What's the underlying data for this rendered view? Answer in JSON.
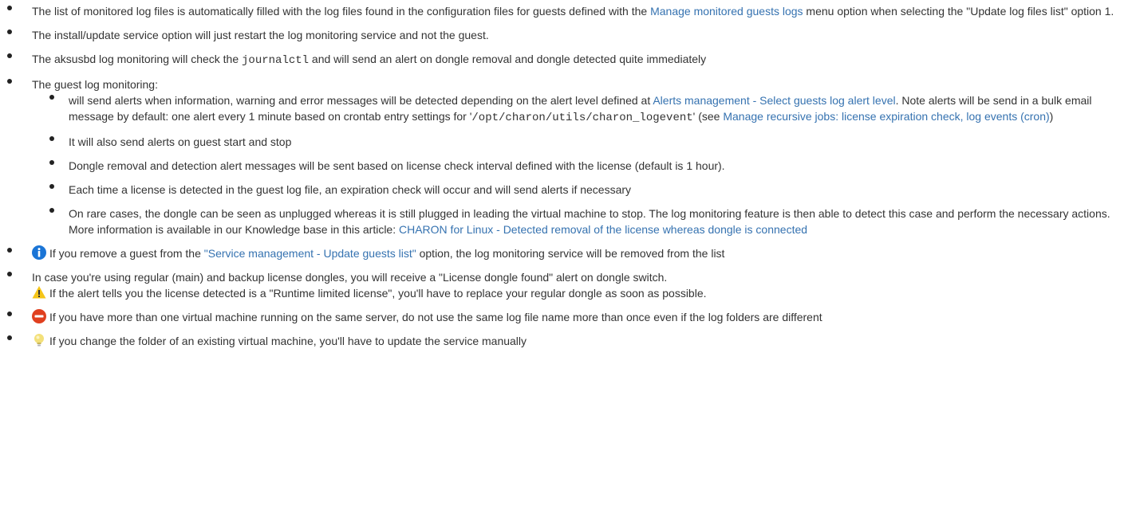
{
  "items": {
    "b1": {
      "t1": "The list of monitored log files is automatically filled with the log files found in the configuration files for guests defined with the ",
      "link": "Manage monitored guests logs",
      "t2": " menu option when selecting the \"Update log files list\" option 1."
    },
    "b2": {
      "t1": "The install/update service option will just restart the log monitoring service and not the guest."
    },
    "b3": {
      "t1": "The aksusbd log monitoring will check the ",
      "code": "journalctl",
      "t2": " and will send an alert on dongle removal and dongle detected quite immediately"
    },
    "b4": {
      "t1": "The guest log monitoring:",
      "s1": {
        "t1": "will send alerts when information, warning and error messages will be detected depending on the alert level defined at ",
        "link1": "Alerts management - Select guests log alert level",
        "t2": ". Note alerts will be send in a bulk email message by default: one alert every 1 minute based on crontab entry settings for '",
        "code": "/opt/charon/utils/charon_logevent",
        "t3": "' (see ",
        "link2": "Manage recursive jobs: license expiration check, log events (cron)",
        "t4": ")"
      },
      "s2": "It will also send alerts on guest start and stop",
      "s3": "Dongle removal and detection alert messages will be sent based on license check interval defined with the license (default is 1 hour).",
      "s4": "Each time a license is detected in the guest log file, an expiration check will occur and will send alerts if necessary",
      "s5": {
        "t1": "On rare cases, the dongle can be seen as unplugged whereas it is still plugged in leading the virtual machine to stop. The log monitoring feature is then able to detect this case and perform the necessary actions. More information is available in our Knowledge base in this article: ",
        "link": "CHARON for Linux - Detected removal of the license whereas dongle is connected"
      }
    },
    "b5": {
      "icon": "info-icon",
      "t1": "If you remove a guest from the ",
      "link": "\"Service management - Update guests list\"",
      "t2": " option, the log monitoring service will be removed from the list"
    },
    "b6": {
      "t1": "In case you're using regular (main) and backup license dongles, you will receive a \"License dongle found\" alert on dongle switch.",
      "icon": "warning-icon",
      "t2": "If the alert tells you the license detected is a \"Runtime limited license\", you'll have to replace your regular dongle as soon as possible."
    },
    "b7": {
      "icon": "error-icon",
      "t1": "If you have more than one virtual machine running on the same server, do not use the same log file name more than once even if the log folders are different"
    },
    "b8": {
      "icon": "lightbulb-icon",
      "t1": "If you change the folder of an existing virtual machine, you'll have to update the service manually"
    }
  },
  "colors": {
    "link": "#3572b0",
    "info": "#1b75d6",
    "warning": "#f5c518",
    "error": "#e0401f",
    "tip": "#f3e07a"
  }
}
